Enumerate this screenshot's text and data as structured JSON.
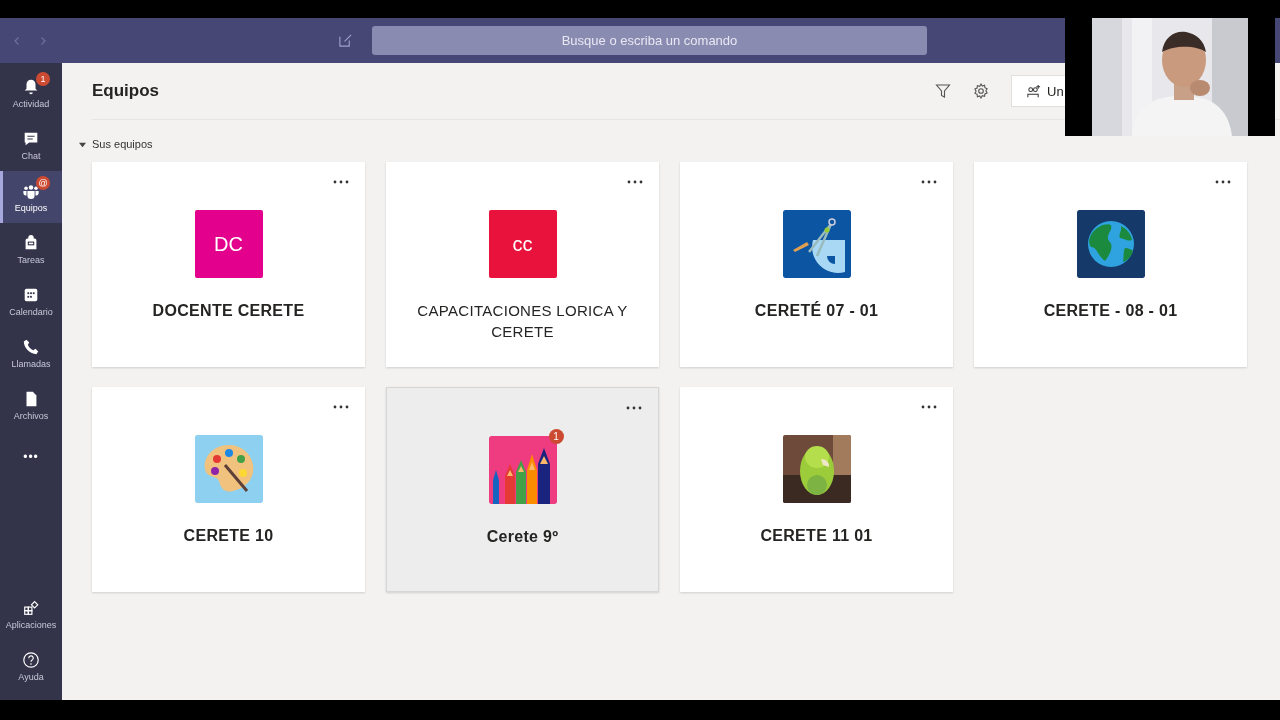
{
  "top_bar": {
    "search": {
      "placeholder": "Busque o escriba un comando"
    }
  },
  "sidebar": {
    "items": [
      {
        "kind": "bell",
        "label": "Actividad",
        "badge": "1",
        "selected": false
      },
      {
        "kind": "chat",
        "label": "Chat",
        "selected": false
      },
      {
        "kind": "teams",
        "label": "Equipos",
        "badge": "@",
        "selected": true
      },
      {
        "kind": "bag",
        "label": "Tareas",
        "selected": false
      },
      {
        "kind": "calendar",
        "label": "Calendario",
        "selected": false
      },
      {
        "kind": "phone",
        "label": "Llamadas",
        "selected": false
      },
      {
        "kind": "file",
        "label": "Archivos",
        "selected": false
      },
      {
        "kind": "more",
        "label": "•••",
        "selected": false
      }
    ],
    "bottom_items": [
      {
        "kind": "apps",
        "label": "Aplicaciones",
        "selected": false
      },
      {
        "kind": "help",
        "label": "Ayuda",
        "selected": false
      }
    ]
  },
  "header": {
    "title": "Equipos",
    "join_button": "Un"
  },
  "section": {
    "label": "Sus equipos",
    "expanded": true
  },
  "teams": [
    {
      "name": "DOCENTE CERETE",
      "bold": true,
      "hovered": false,
      "avatar": {
        "kind": "initials",
        "text": "DC",
        "color": "#e3008c"
      }
    },
    {
      "name": "CAPACITACIONES LORICA Y CERETE",
      "bold": false,
      "hovered": false,
      "avatar": {
        "kind": "initials",
        "text": "cc",
        "color": "#e8123c"
      }
    },
    {
      "name": "CERETÉ 07 - 01",
      "bold": true,
      "hovered": false,
      "avatar": {
        "kind": "compass"
      }
    },
    {
      "name": "CERETE - 08 - 01",
      "bold": true,
      "hovered": false,
      "avatar": {
        "kind": "globe"
      }
    },
    {
      "name": "CERETE 10",
      "bold": true,
      "hovered": false,
      "avatar": {
        "kind": "palette"
      }
    },
    {
      "name": "Cerete 9º",
      "bold": true,
      "hovered": true,
      "badge": "1",
      "avatar": {
        "kind": "pencils"
      }
    },
    {
      "name": "CERETE 11 01",
      "bold": true,
      "hovered": false
    }
  ]
}
